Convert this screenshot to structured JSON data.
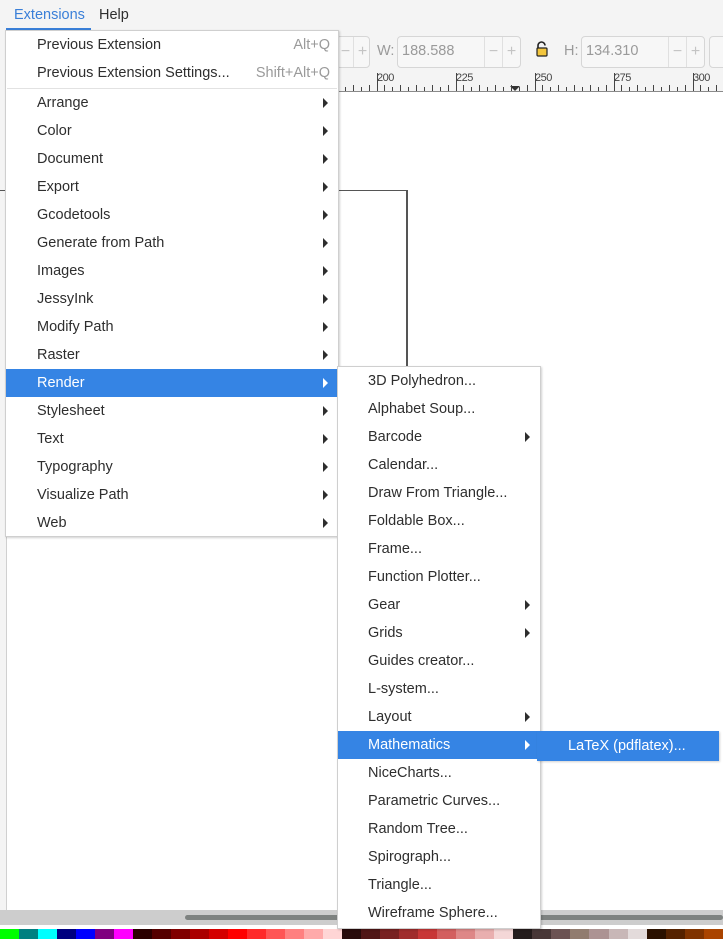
{
  "menubar": {
    "items": [
      {
        "label": "Extensions",
        "active": true
      },
      {
        "label": "Help",
        "active": false
      }
    ]
  },
  "toolbar": {
    "w_label": "W:",
    "w_value": "188.588",
    "h_label": "H:",
    "h_value": "134.310",
    "minus": "−",
    "plus": "+",
    "lock_icon": "lock-open-icon"
  },
  "ruler": {
    "labels": [
      "200",
      "225",
      "250",
      "275",
      "300"
    ]
  },
  "extensions_menu": {
    "top_items": [
      {
        "label": "Previous Extension",
        "accel": "Alt+Q"
      },
      {
        "label": "Previous Extension Settings...",
        "accel": "Shift+Alt+Q"
      }
    ],
    "items": [
      {
        "label": "Arrange",
        "submenu": true
      },
      {
        "label": "Color",
        "submenu": true
      },
      {
        "label": "Document",
        "submenu": true
      },
      {
        "label": "Export",
        "submenu": true
      },
      {
        "label": "Gcodetools",
        "submenu": true
      },
      {
        "label": "Generate from Path",
        "submenu": true
      },
      {
        "label": "Images",
        "submenu": true
      },
      {
        "label": "JessyInk",
        "submenu": true
      },
      {
        "label": "Modify Path",
        "submenu": true
      },
      {
        "label": "Raster",
        "submenu": true
      },
      {
        "label": "Render",
        "submenu": true,
        "highlighted": true
      },
      {
        "label": "Stylesheet",
        "submenu": true
      },
      {
        "label": "Text",
        "submenu": true
      },
      {
        "label": "Typography",
        "submenu": true
      },
      {
        "label": "Visualize Path",
        "submenu": true
      },
      {
        "label": "Web",
        "submenu": true
      }
    ]
  },
  "render_menu": {
    "items": [
      {
        "label": "3D Polyhedron...",
        "submenu": false
      },
      {
        "label": "Alphabet Soup...",
        "submenu": false
      },
      {
        "label": "Barcode",
        "submenu": true
      },
      {
        "label": "Calendar...",
        "submenu": false
      },
      {
        "label": "Draw From Triangle...",
        "submenu": false
      },
      {
        "label": "Foldable Box...",
        "submenu": false
      },
      {
        "label": "Frame...",
        "submenu": false
      },
      {
        "label": "Function Plotter...",
        "submenu": false
      },
      {
        "label": "Gear",
        "submenu": true
      },
      {
        "label": "Grids",
        "submenu": true
      },
      {
        "label": "Guides creator...",
        "submenu": false
      },
      {
        "label": "L-system...",
        "submenu": false
      },
      {
        "label": "Layout",
        "submenu": true
      },
      {
        "label": "Mathematics",
        "submenu": true,
        "highlighted": true
      },
      {
        "label": "NiceCharts...",
        "submenu": false
      },
      {
        "label": "Parametric Curves...",
        "submenu": false
      },
      {
        "label": "Random Tree...",
        "submenu": false
      },
      {
        "label": "Spirograph...",
        "submenu": false
      },
      {
        "label": "Triangle...",
        "submenu": false
      },
      {
        "label": "Wireframe Sphere...",
        "submenu": false
      }
    ]
  },
  "mathematics_menu": {
    "items": [
      {
        "label": "LaTeX (pdflatex)...",
        "highlighted": true
      }
    ]
  },
  "colors": {
    "accent": "#3584e4",
    "menubar_active": "#3a7fd8"
  },
  "palette": [
    "#00ff00",
    "#008080",
    "#00ffff",
    "#000080",
    "#0000ff",
    "#800080",
    "#ff00ff",
    "#2b0000",
    "#550000",
    "#800000",
    "#aa0000",
    "#d40000",
    "#ff0000",
    "#ff2a2a",
    "#ff5555",
    "#ff8080",
    "#ffaaaa",
    "#ffd5d5",
    "#280b0b",
    "#501616",
    "#782121",
    "#a02c2c",
    "#c83737",
    "#d35f5f",
    "#de8787",
    "#e9afaf",
    "#f4d7d7",
    "#241c1c",
    "#483737",
    "#6c5353",
    "#917c6f",
    "#ac9393",
    "#c8b7b7",
    "#e3dbdb",
    "#2b1100",
    "#552200",
    "#803300",
    "#aa4400"
  ]
}
